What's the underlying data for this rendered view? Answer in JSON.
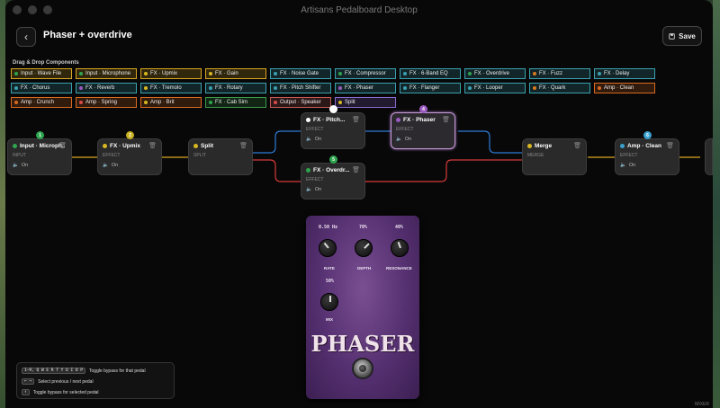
{
  "window": {
    "title": "Artisans Pedalboard Desktop"
  },
  "header": {
    "title": "Phaser + overdrive",
    "back_icon": "chevron-left-icon",
    "save_label": "Save",
    "save_icon": "save-icon"
  },
  "palette": {
    "label": "Drag & Drop Components",
    "items": [
      {
        "label": "Input · Wave File",
        "color": "#d9a521",
        "dot": "#2ea44f"
      },
      {
        "label": "Input · Microphone",
        "color": "#d9a521",
        "dot": "#2ea44f"
      },
      {
        "label": "FX · Upmix",
        "color": "#d9a521",
        "dot": "#d9b821"
      },
      {
        "label": "FX · Gain",
        "color": "#d9a521",
        "dot": "#d9b821"
      },
      {
        "label": "FX · Noise Gate",
        "color": "#3aa0b0",
        "dot": "#3aa0b0"
      },
      {
        "label": "FX · Compressor",
        "color": "#3aa0b0",
        "dot": "#2ea44f"
      },
      {
        "label": "FX · 6-Band EQ",
        "color": "#3aa0b0",
        "dot": "#3aa0b0"
      },
      {
        "label": "FX · Overdrive",
        "color": "#3aa0b0",
        "dot": "#2ea44f"
      },
      {
        "label": "FX · Fuzz",
        "color": "#3aa0b0",
        "dot": "#d97a21"
      },
      {
        "label": "FX · Delay",
        "color": "#3aa0b0",
        "dot": "#3aa0b0"
      },
      {
        "label": "FX · Chorus",
        "color": "#3aa0b0",
        "dot": "#3aa0b0"
      },
      {
        "label": "FX · Reverb",
        "color": "#3aa0b0",
        "dot": "#9a5ac0"
      },
      {
        "label": "FX · Tremolo",
        "color": "#3aa0b0",
        "dot": "#d9b821"
      },
      {
        "label": "FX · Rotary",
        "color": "#3aa0b0",
        "dot": "#3aa0b0"
      },
      {
        "label": "FX · Pitch Shifter",
        "color": "#3aa0b0",
        "dot": "#3aa0b0"
      },
      {
        "label": "FX · Phaser",
        "color": "#3aa0b0",
        "dot": "#9a5ac0"
      },
      {
        "label": "FX · Flanger",
        "color": "#3aa0b0",
        "dot": "#3aa0b0"
      },
      {
        "label": "FX · Looper",
        "color": "#3aa0b0",
        "dot": "#3aa0b0"
      },
      {
        "label": "FX · Quark",
        "color": "#3aa0b0",
        "dot": "#d97a21"
      },
      {
        "label": "Amp · Clean",
        "color": "#d96a21",
        "dot": "#d96a21"
      },
      {
        "label": "Amp · Crunch",
        "color": "#d96a21",
        "dot": "#d96a21"
      },
      {
        "label": "Amp · Spring",
        "color": "#d96a21",
        "dot": "#d94a4a"
      },
      {
        "label": "Amp · Brit",
        "color": "#d96a21",
        "dot": "#d9b821"
      },
      {
        "label": "FX · Cab Sim",
        "color": "#3a9a4a",
        "dot": "#2ea44f"
      },
      {
        "label": "Output · Speaker",
        "color": "#c45a5a",
        "dot": "#d94a4a"
      },
      {
        "label": "Split",
        "color": "#8a6ad0",
        "dot": "#d9b821"
      }
    ]
  },
  "nodes": [
    {
      "name": "Input · Microph...",
      "kind": "INPUT",
      "on": "On",
      "dot": "#2ea44f",
      "badge": "1",
      "badge_color": "#2ea44f"
    },
    {
      "name": "FX · Upmix",
      "kind": "EFFECT",
      "on": "On",
      "dot": "#d9b821",
      "badge": "2",
      "badge_color": "#c9b020"
    },
    {
      "name": "Split",
      "kind": "SPLIT",
      "on": "",
      "dot": "#d9b821",
      "badge": "",
      "badge_color": ""
    },
    {
      "name": "FX · Pitch...",
      "kind": "EFFECT",
      "on": "On",
      "dot": "#ffffff",
      "badge": "",
      "badge_color": "#ffffff"
    },
    {
      "name": "FX · Overdr...",
      "kind": "EFFECT",
      "on": "On",
      "dot": "#2ea44f",
      "badge": "5",
      "badge_color": "#2ea44f"
    },
    {
      "name": "FX · Phaser",
      "kind": "EFFECT",
      "on": "On",
      "dot": "#9a5ac0",
      "badge": "4",
      "badge_color": "#9a5ac0"
    },
    {
      "name": "Merge",
      "kind": "MERGE",
      "on": "",
      "dot": "#d9b821",
      "badge": "",
      "badge_color": ""
    },
    {
      "name": "Amp · Clean",
      "kind": "EFFECT",
      "on": "On",
      "dot": "#3aa0d0",
      "badge": "6",
      "badge_color": "#3aa0d0"
    }
  ],
  "pedal": {
    "name": "PHASER",
    "rate": {
      "label": "RATE",
      "value": "0.50 Hz"
    },
    "depth": {
      "label": "DEPTH",
      "value": "70%"
    },
    "resonance": {
      "label": "RESONANCE",
      "value": "40%"
    },
    "mix": {
      "label": "MIX",
      "value": "50%"
    }
  },
  "shortcuts": [
    {
      "keys": "1–9, Q W E R T Y U I O P",
      "desc": "Toggle bypass for that pedal"
    },
    {
      "keys": "← →",
      "desc": "Select previous / next pedal"
    },
    {
      "keys": "↑",
      "desc": "Toggle bypass for selected pedal"
    }
  ],
  "corner": "MIXER"
}
